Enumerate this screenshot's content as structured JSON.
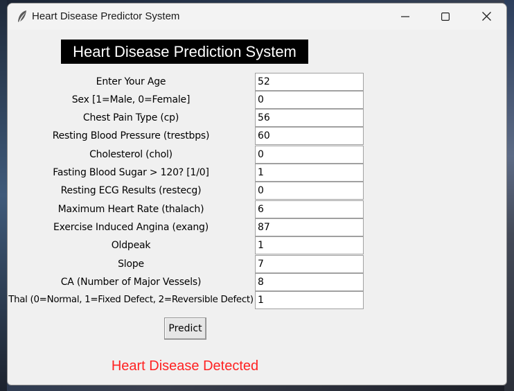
{
  "window": {
    "title": "Heart Disease Predictor System"
  },
  "heading": "Heart Disease Prediction System",
  "fields": [
    {
      "label": "Enter Your Age",
      "value": "52"
    },
    {
      "label": "Sex [1=Male, 0=Female]",
      "value": "0"
    },
    {
      "label": "Chest Pain Type (cp)",
      "value": "56"
    },
    {
      "label": "Resting Blood Pressure (trestbps)",
      "value": "60"
    },
    {
      "label": "Cholesterol (chol)",
      "value": "0"
    },
    {
      "label": "Fasting Blood Sugar > 120? [1/0]",
      "value": "1"
    },
    {
      "label": "Resting ECG Results (restecg)",
      "value": "0"
    },
    {
      "label": "Maximum Heart Rate (thalach)",
      "value": "6"
    },
    {
      "label": "Exercise Induced Angina (exang)",
      "value": "87"
    },
    {
      "label": "Oldpeak",
      "value": "1"
    },
    {
      "label": "Slope",
      "value": "7"
    },
    {
      "label": "CA (Number of Major Vessels)",
      "value": "8"
    },
    {
      "label": "Thal (0=Normal, 1=Fixed Defect, 2=Reversible Defect)",
      "value": "1"
    }
  ],
  "predict_label": "Predict",
  "result": {
    "text": "Heart Disease Detected",
    "color": "#ff2222"
  },
  "icons": {
    "app": "feather-icon",
    "minimize": "minimize-icon",
    "maximize": "maximize-icon",
    "close": "close-icon"
  }
}
